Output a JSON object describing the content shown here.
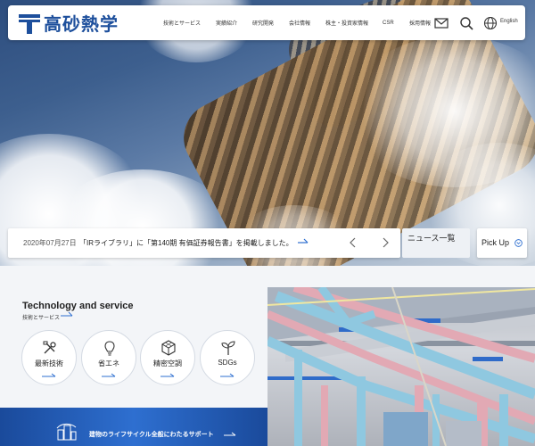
{
  "header": {
    "logo_text": "高砂熱学",
    "nav": [
      "技術とサービス",
      "実績紹介",
      "研究開発",
      "会社情報",
      "株主・投資家情報",
      "CSR",
      "採用情報"
    ],
    "icons": [
      "mail-icon",
      "search-icon",
      "globe-icon"
    ],
    "language_label": "English"
  },
  "news": {
    "date": "2020年07月27日",
    "text": "「IRライブラリ」に「第140期 有価証券報告書」を掲載しました。",
    "list_label": "ニュース一覧",
    "pickup_label": "Pick Up"
  },
  "technology": {
    "title": "Technology and service",
    "subtitle": "技術とサービス",
    "services": [
      {
        "label": "最新技術",
        "icon": "tools-icon"
      },
      {
        "label": "省エネ",
        "icon": "lightbulb-icon"
      },
      {
        "label": "精密空調",
        "icon": "cube-icon"
      },
      {
        "label": "SDGs",
        "icon": "sprout-icon"
      }
    ]
  },
  "banner": {
    "text": "建物のライフサイクル全般にわたるサポート"
  },
  "colors": {
    "brand": "#1d4f9c",
    "accent": "#2e6fd0",
    "panel_bg": "#f3f5f8"
  }
}
